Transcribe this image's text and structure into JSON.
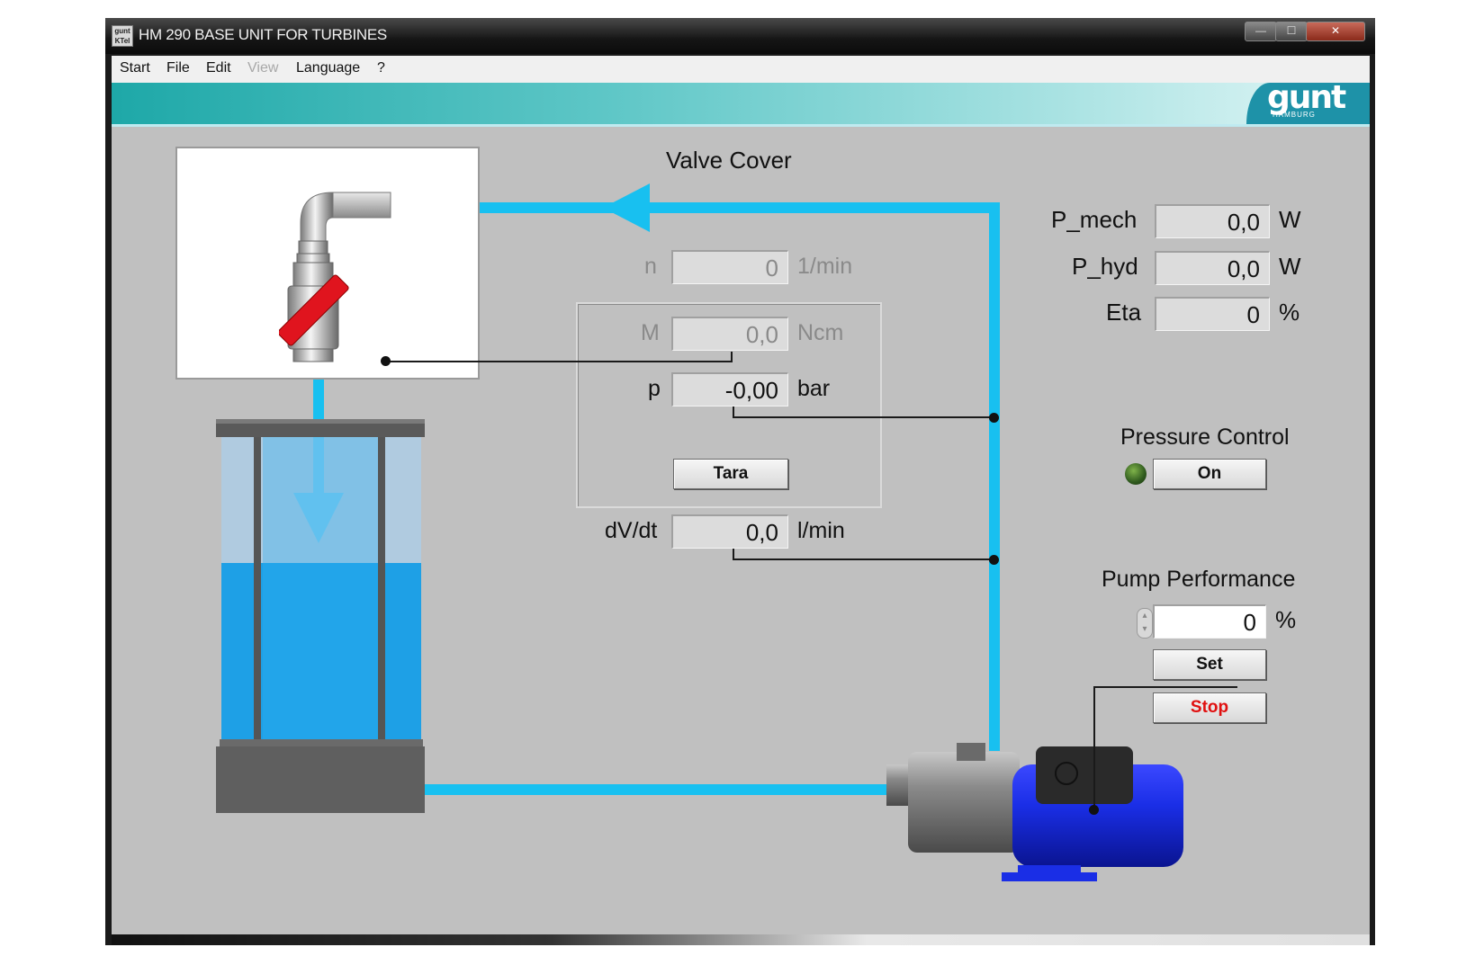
{
  "window": {
    "title": "HM 290 BASE UNIT FOR TURBINES",
    "app_icon_text": "gunt KTel"
  },
  "titlebar_buttons": {
    "minimize": "—",
    "maximize": "☐",
    "close": "✕"
  },
  "menu": {
    "items": [
      "Start",
      "File",
      "Edit",
      "View",
      "Language",
      "?"
    ],
    "disabled": [
      "View"
    ]
  },
  "logo": {
    "text": "gunt",
    "subtext": "HAMBURG"
  },
  "schematic": {
    "valve_label": "Valve Cover",
    "n": {
      "label": "n",
      "value": "0",
      "unit": "1/min"
    },
    "M": {
      "label": "M",
      "value": "0,0",
      "unit": "Ncm"
    },
    "p": {
      "label": "p",
      "value": "-0,00",
      "unit": "bar"
    },
    "tara_button": "Tara",
    "flow": {
      "label": "dV/dt",
      "value": "0,0",
      "unit": "l/min"
    }
  },
  "results": [
    {
      "label": "P_mech",
      "value": "0,0",
      "unit": "W"
    },
    {
      "label": "P_hyd",
      "value": "0,0",
      "unit": "W"
    },
    {
      "label": "Eta",
      "value": "0",
      "unit": "%"
    }
  ],
  "pressure_control": {
    "title": "Pressure Control",
    "button": "On",
    "indicator_color": "#2f5a1e"
  },
  "pump_performance": {
    "title": "Pump Performance",
    "value": "0",
    "unit": "%",
    "set_button": "Set",
    "stop_button": "Stop"
  },
  "colors": {
    "water": "#18c0f0",
    "pump_motor": "#1a2ee6",
    "stop_text": "#e01010"
  }
}
